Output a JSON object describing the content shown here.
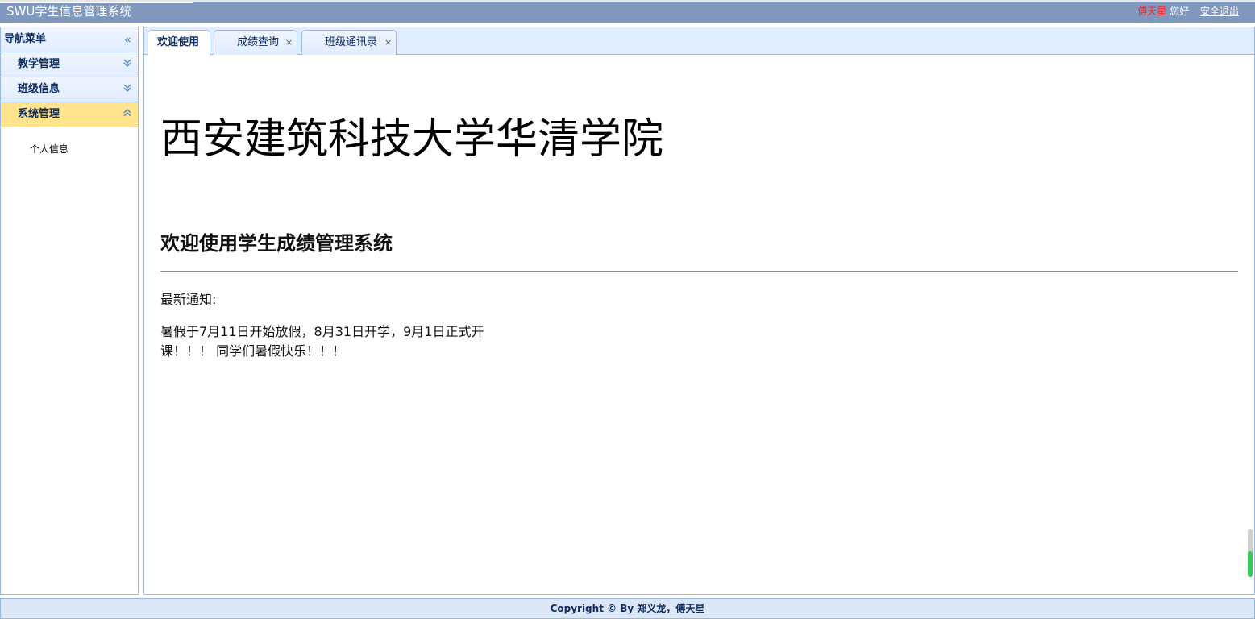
{
  "header": {
    "app_title": "SWU学生信息管理系统",
    "user_name": "傅天星",
    "greeting": "您好",
    "logout_label": "安全退出"
  },
  "sidebar": {
    "title": "导航菜单",
    "collapse_icon": "double-chevron-left-icon",
    "items": [
      {
        "label": "教学管理",
        "icon": "double-chevron-down-icon",
        "expanded": false
      },
      {
        "label": "班级信息",
        "icon": "double-chevron-down-icon",
        "expanded": false
      },
      {
        "label": "系统管理",
        "icon": "double-chevron-up-icon",
        "expanded": true,
        "children": [
          "个人信息"
        ]
      }
    ]
  },
  "tabs": [
    {
      "label": "欢迎使用",
      "active": true,
      "closable": false
    },
    {
      "label": "成绩查询",
      "active": false,
      "closable": true
    },
    {
      "label": "班级通讯录",
      "active": false,
      "closable": true
    }
  ],
  "main": {
    "school_name": "西安建筑科技大学华清学院",
    "welcome": "欢迎使用学生成绩管理系统",
    "notice_label": "最新通知:",
    "notice_text": "暑假于7月11日开始放假，8月31日开学，9月1日正式开课！！！ 同学们暑假快乐！！！"
  },
  "footer": {
    "copyright": "Copyright © By 郑义龙，傅天星"
  },
  "colors": {
    "topbar": "#7f99be",
    "selected_menu": "#ffe48d",
    "user_name": "#ff2020",
    "border": "#95b8e7"
  }
}
